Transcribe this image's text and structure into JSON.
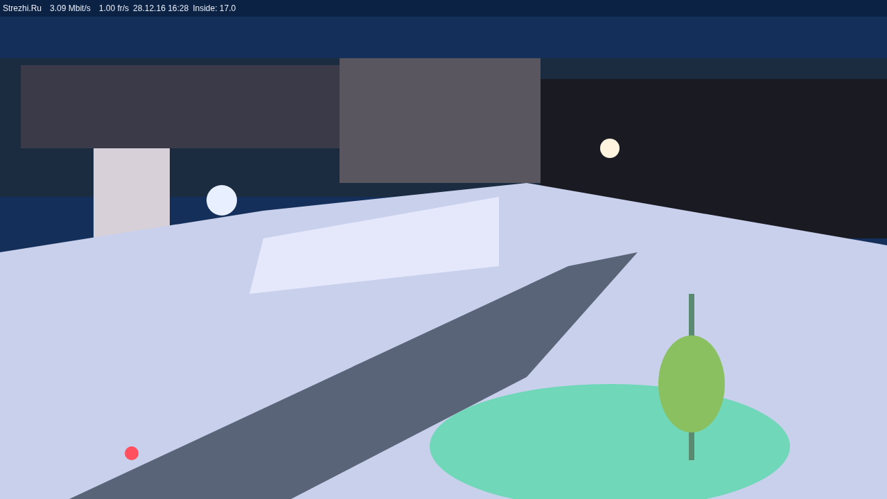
{
  "status_bar": {
    "items": [
      {
        "kind": "site",
        "text": "Strezhi.Ru"
      },
      {
        "kind": "bitrate",
        "text": "3.09 Mbit/s"
      },
      {
        "kind": "framerate",
        "text": "1.00 fr/s"
      },
      {
        "kind": "timestamp",
        "text": "28.12.16 16:28"
      },
      {
        "kind": "temperature",
        "text": "Inside: 17.0"
      }
    ]
  }
}
